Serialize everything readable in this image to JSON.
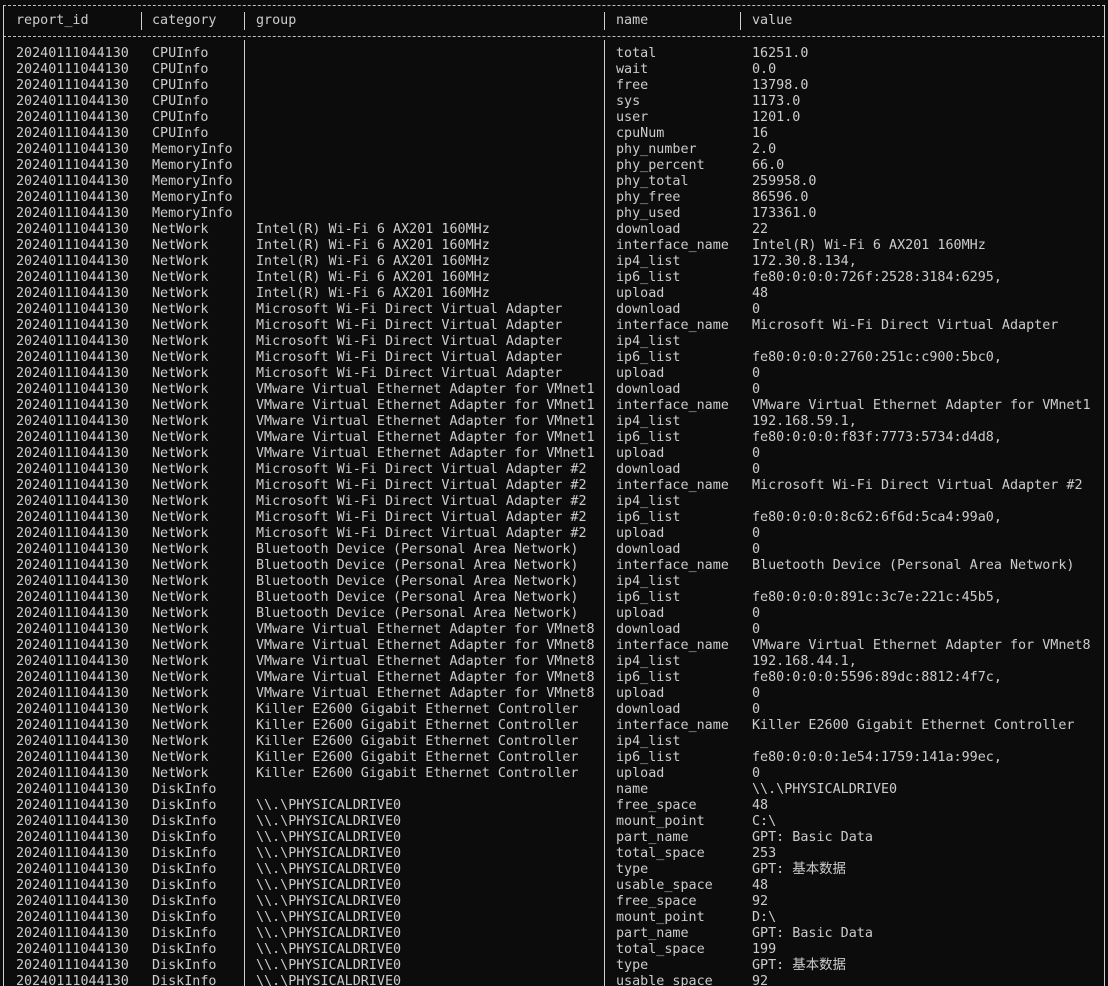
{
  "table": {
    "headers": {
      "report_id": "report_id",
      "category": "category",
      "group": "group",
      "name": "name",
      "value": "value"
    },
    "rows": [
      {
        "report_id": "20240111044130",
        "category": "CPUInfo",
        "group": "",
        "name": "total",
        "value": "16251.0"
      },
      {
        "report_id": "20240111044130",
        "category": "CPUInfo",
        "group": "",
        "name": "wait",
        "value": "0.0"
      },
      {
        "report_id": "20240111044130",
        "category": "CPUInfo",
        "group": "",
        "name": "free",
        "value": "13798.0"
      },
      {
        "report_id": "20240111044130",
        "category": "CPUInfo",
        "group": "",
        "name": "sys",
        "value": "1173.0"
      },
      {
        "report_id": "20240111044130",
        "category": "CPUInfo",
        "group": "",
        "name": "user",
        "value": "1201.0"
      },
      {
        "report_id": "20240111044130",
        "category": "CPUInfo",
        "group": "",
        "name": "cpuNum",
        "value": "16"
      },
      {
        "report_id": "20240111044130",
        "category": "MemoryInfo",
        "group": "",
        "name": "phy_number",
        "value": "2.0"
      },
      {
        "report_id": "20240111044130",
        "category": "MemoryInfo",
        "group": "",
        "name": "phy_percent",
        "value": "66.0"
      },
      {
        "report_id": "20240111044130",
        "category": "MemoryInfo",
        "group": "",
        "name": "phy_total",
        "value": "259958.0"
      },
      {
        "report_id": "20240111044130",
        "category": "MemoryInfo",
        "group": "",
        "name": "phy_free",
        "value": "86596.0"
      },
      {
        "report_id": "20240111044130",
        "category": "MemoryInfo",
        "group": "",
        "name": "phy_used",
        "value": "173361.0"
      },
      {
        "report_id": "20240111044130",
        "category": "NetWork",
        "group": "Intel(R) Wi-Fi 6 AX201 160MHz",
        "name": "download",
        "value": "22"
      },
      {
        "report_id": "20240111044130",
        "category": "NetWork",
        "group": "Intel(R) Wi-Fi 6 AX201 160MHz",
        "name": "interface_name",
        "value": "Intel(R) Wi-Fi 6 AX201 160MHz"
      },
      {
        "report_id": "20240111044130",
        "category": "NetWork",
        "group": "Intel(R) Wi-Fi 6 AX201 160MHz",
        "name": "ip4_list",
        "value": "172.30.8.134,"
      },
      {
        "report_id": "20240111044130",
        "category": "NetWork",
        "group": "Intel(R) Wi-Fi 6 AX201 160MHz",
        "name": "ip6_list",
        "value": "fe80:0:0:0:726f:2528:3184:6295,"
      },
      {
        "report_id": "20240111044130",
        "category": "NetWork",
        "group": "Intel(R) Wi-Fi 6 AX201 160MHz",
        "name": "upload",
        "value": "48"
      },
      {
        "report_id": "20240111044130",
        "category": "NetWork",
        "group": "Microsoft Wi-Fi Direct Virtual Adapter",
        "name": "download",
        "value": "0"
      },
      {
        "report_id": "20240111044130",
        "category": "NetWork",
        "group": "Microsoft Wi-Fi Direct Virtual Adapter",
        "name": "interface_name",
        "value": "Microsoft Wi-Fi Direct Virtual Adapter"
      },
      {
        "report_id": "20240111044130",
        "category": "NetWork",
        "group": "Microsoft Wi-Fi Direct Virtual Adapter",
        "name": "ip4_list",
        "value": ""
      },
      {
        "report_id": "20240111044130",
        "category": "NetWork",
        "group": "Microsoft Wi-Fi Direct Virtual Adapter",
        "name": "ip6_list",
        "value": "fe80:0:0:0:2760:251c:c900:5bc0,"
      },
      {
        "report_id": "20240111044130",
        "category": "NetWork",
        "group": "Microsoft Wi-Fi Direct Virtual Adapter",
        "name": "upload",
        "value": "0"
      },
      {
        "report_id": "20240111044130",
        "category": "NetWork",
        "group": "VMware Virtual Ethernet Adapter for VMnet1",
        "name": "download",
        "value": "0"
      },
      {
        "report_id": "20240111044130",
        "category": "NetWork",
        "group": "VMware Virtual Ethernet Adapter for VMnet1",
        "name": "interface_name",
        "value": "VMware Virtual Ethernet Adapter for VMnet1"
      },
      {
        "report_id": "20240111044130",
        "category": "NetWork",
        "group": "VMware Virtual Ethernet Adapter for VMnet1",
        "name": "ip4_list",
        "value": "192.168.59.1,"
      },
      {
        "report_id": "20240111044130",
        "category": "NetWork",
        "group": "VMware Virtual Ethernet Adapter for VMnet1",
        "name": "ip6_list",
        "value": "fe80:0:0:0:f83f:7773:5734:d4d8,"
      },
      {
        "report_id": "20240111044130",
        "category": "NetWork",
        "group": "VMware Virtual Ethernet Adapter for VMnet1",
        "name": "upload",
        "value": "0"
      },
      {
        "report_id": "20240111044130",
        "category": "NetWork",
        "group": "Microsoft Wi-Fi Direct Virtual Adapter #2",
        "name": "download",
        "value": "0"
      },
      {
        "report_id": "20240111044130",
        "category": "NetWork",
        "group": "Microsoft Wi-Fi Direct Virtual Adapter #2",
        "name": "interface_name",
        "value": "Microsoft Wi-Fi Direct Virtual Adapter #2"
      },
      {
        "report_id": "20240111044130",
        "category": "NetWork",
        "group": "Microsoft Wi-Fi Direct Virtual Adapter #2",
        "name": "ip4_list",
        "value": ""
      },
      {
        "report_id": "20240111044130",
        "category": "NetWork",
        "group": "Microsoft Wi-Fi Direct Virtual Adapter #2",
        "name": "ip6_list",
        "value": "fe80:0:0:0:8c62:6f6d:5ca4:99a0,"
      },
      {
        "report_id": "20240111044130",
        "category": "NetWork",
        "group": "Microsoft Wi-Fi Direct Virtual Adapter #2",
        "name": "upload",
        "value": "0"
      },
      {
        "report_id": "20240111044130",
        "category": "NetWork",
        "group": "Bluetooth Device (Personal Area Network)",
        "name": "download",
        "value": "0"
      },
      {
        "report_id": "20240111044130",
        "category": "NetWork",
        "group": "Bluetooth Device (Personal Area Network)",
        "name": "interface_name",
        "value": "Bluetooth Device (Personal Area Network)"
      },
      {
        "report_id": "20240111044130",
        "category": "NetWork",
        "group": "Bluetooth Device (Personal Area Network)",
        "name": "ip4_list",
        "value": ""
      },
      {
        "report_id": "20240111044130",
        "category": "NetWork",
        "group": "Bluetooth Device (Personal Area Network)",
        "name": "ip6_list",
        "value": "fe80:0:0:0:891c:3c7e:221c:45b5,"
      },
      {
        "report_id": "20240111044130",
        "category": "NetWork",
        "group": "Bluetooth Device (Personal Area Network)",
        "name": "upload",
        "value": "0"
      },
      {
        "report_id": "20240111044130",
        "category": "NetWork",
        "group": "VMware Virtual Ethernet Adapter for VMnet8",
        "name": "download",
        "value": "0"
      },
      {
        "report_id": "20240111044130",
        "category": "NetWork",
        "group": "VMware Virtual Ethernet Adapter for VMnet8",
        "name": "interface_name",
        "value": "VMware Virtual Ethernet Adapter for VMnet8"
      },
      {
        "report_id": "20240111044130",
        "category": "NetWork",
        "group": "VMware Virtual Ethernet Adapter for VMnet8",
        "name": "ip4_list",
        "value": "192.168.44.1,"
      },
      {
        "report_id": "20240111044130",
        "category": "NetWork",
        "group": "VMware Virtual Ethernet Adapter for VMnet8",
        "name": "ip6_list",
        "value": "fe80:0:0:0:5596:89dc:8812:4f7c,"
      },
      {
        "report_id": "20240111044130",
        "category": "NetWork",
        "group": "VMware Virtual Ethernet Adapter for VMnet8",
        "name": "upload",
        "value": "0"
      },
      {
        "report_id": "20240111044130",
        "category": "NetWork",
        "group": "Killer E2600 Gigabit Ethernet Controller",
        "name": "download",
        "value": "0"
      },
      {
        "report_id": "20240111044130",
        "category": "NetWork",
        "group": "Killer E2600 Gigabit Ethernet Controller",
        "name": "interface_name",
        "value": "Killer E2600 Gigabit Ethernet Controller"
      },
      {
        "report_id": "20240111044130",
        "category": "NetWork",
        "group": "Killer E2600 Gigabit Ethernet Controller",
        "name": "ip4_list",
        "value": ""
      },
      {
        "report_id": "20240111044130",
        "category": "NetWork",
        "group": "Killer E2600 Gigabit Ethernet Controller",
        "name": "ip6_list",
        "value": "fe80:0:0:0:1e54:1759:141a:99ec,"
      },
      {
        "report_id": "20240111044130",
        "category": "NetWork",
        "group": "Killer E2600 Gigabit Ethernet Controller",
        "name": "upload",
        "value": "0"
      },
      {
        "report_id": "20240111044130",
        "category": "DiskInfo",
        "group": "",
        "name": "name",
        "value": "\\\\.\\PHYSICALDRIVE0"
      },
      {
        "report_id": "20240111044130",
        "category": "DiskInfo",
        "group": "\\\\.\\PHYSICALDRIVE0",
        "name": "free_space",
        "value": "48"
      },
      {
        "report_id": "20240111044130",
        "category": "DiskInfo",
        "group": "\\\\.\\PHYSICALDRIVE0",
        "name": "mount_point",
        "value": "C:\\"
      },
      {
        "report_id": "20240111044130",
        "category": "DiskInfo",
        "group": "\\\\.\\PHYSICALDRIVE0",
        "name": "part_name",
        "value": "GPT: Basic Data"
      },
      {
        "report_id": "20240111044130",
        "category": "DiskInfo",
        "group": "\\\\.\\PHYSICALDRIVE0",
        "name": "total_space",
        "value": "253"
      },
      {
        "report_id": "20240111044130",
        "category": "DiskInfo",
        "group": "\\\\.\\PHYSICALDRIVE0",
        "name": "type",
        "value": "GPT: 基本数据"
      },
      {
        "report_id": "20240111044130",
        "category": "DiskInfo",
        "group": "\\\\.\\PHYSICALDRIVE0",
        "name": "usable_space",
        "value": "48"
      },
      {
        "report_id": "20240111044130",
        "category": "DiskInfo",
        "group": "\\\\.\\PHYSICALDRIVE0",
        "name": "free_space",
        "value": "92"
      },
      {
        "report_id": "20240111044130",
        "category": "DiskInfo",
        "group": "\\\\.\\PHYSICALDRIVE0",
        "name": "mount_point",
        "value": "D:\\"
      },
      {
        "report_id": "20240111044130",
        "category": "DiskInfo",
        "group": "\\\\.\\PHYSICALDRIVE0",
        "name": "part_name",
        "value": "GPT: Basic Data"
      },
      {
        "report_id": "20240111044130",
        "category": "DiskInfo",
        "group": "\\\\.\\PHYSICALDRIVE0",
        "name": "total_space",
        "value": "199"
      },
      {
        "report_id": "20240111044130",
        "category": "DiskInfo",
        "group": "\\\\.\\PHYSICALDRIVE0",
        "name": "type",
        "value": "GPT: 基本数据"
      },
      {
        "report_id": "20240111044130",
        "category": "DiskInfo",
        "group": "\\\\.\\PHYSICALDRIVE0",
        "name": "usable_space",
        "value": "92"
      }
    ]
  }
}
